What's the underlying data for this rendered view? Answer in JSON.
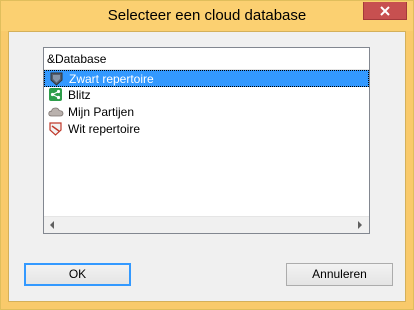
{
  "window": {
    "title": "Selecteer een cloud database"
  },
  "list": {
    "header": "&Database",
    "items": [
      {
        "label": "Zwart repertoire",
        "icon": "black-repertoire-icon",
        "selected": true
      },
      {
        "label": "Blitz",
        "icon": "share-icon",
        "selected": false
      },
      {
        "label": "Mijn Partijen",
        "icon": "cloud-icon",
        "selected": false
      },
      {
        "label": "Wit repertoire",
        "icon": "white-repertoire-icon",
        "selected": false
      }
    ]
  },
  "buttons": {
    "ok_label": "OK",
    "cancel_label": "Annuleren"
  },
  "colors": {
    "selection": "#3399ff",
    "frame": "#fbd071",
    "close": "#c75050"
  }
}
